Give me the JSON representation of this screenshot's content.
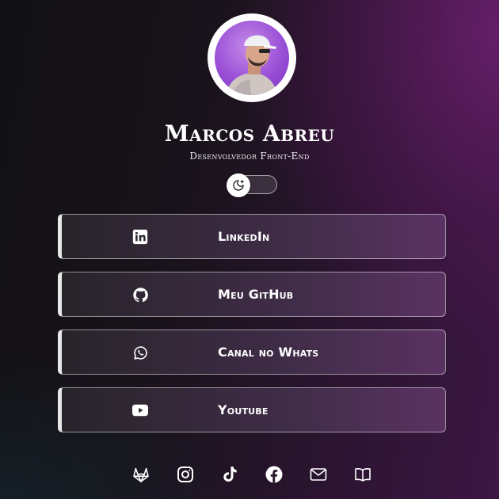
{
  "profile": {
    "name": "Marcos Abreu",
    "role": "Desenvolvedor Front-End",
    "avatar_bg": "#9a4fd6"
  },
  "theme_toggle": {
    "state": "dark",
    "icon": "moon-icon"
  },
  "links": [
    {
      "label": "LinkedIn",
      "icon": "linkedin-icon"
    },
    {
      "label": "Meu GitHub",
      "icon": "github-icon"
    },
    {
      "label": "Canal no Whats",
      "icon": "whatsapp-icon"
    },
    {
      "label": "Youtube",
      "icon": "youtube-icon"
    }
  ],
  "social": [
    "gitlab-icon",
    "instagram-icon",
    "tiktok-icon",
    "facebook-icon",
    "mail-icon",
    "book-icon"
  ],
  "colors": {
    "accent": "#6e2070",
    "card_border_left": "#e8e8e8",
    "text": "#ffffff"
  }
}
